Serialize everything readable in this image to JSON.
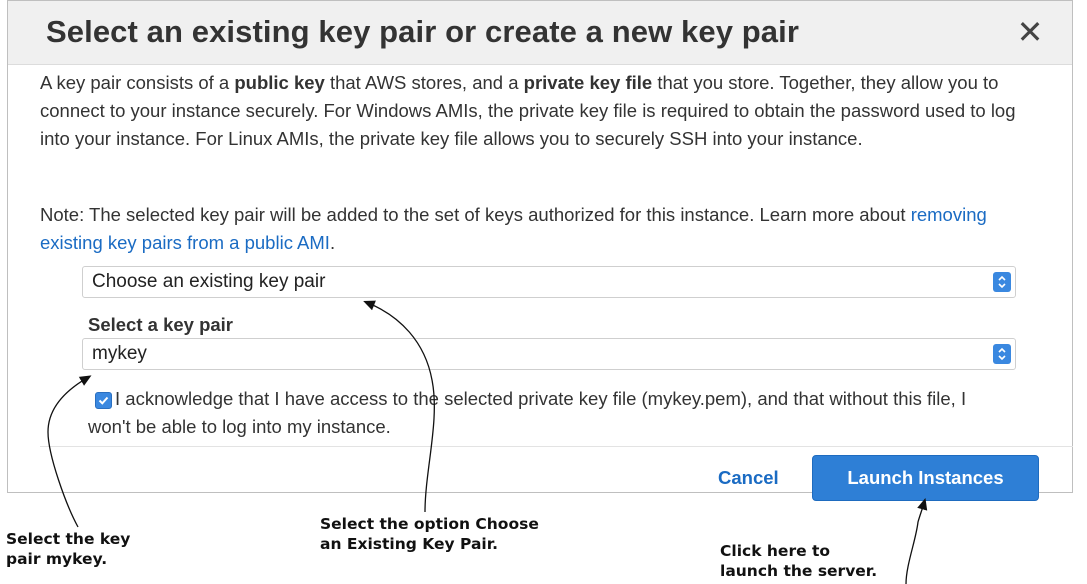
{
  "dialog": {
    "title": "Select an existing key pair or create a new key pair",
    "close_glyph": "✕",
    "para1": {
      "t1": "A key pair consists of a ",
      "b1": "public key",
      "t2": " that AWS stores, and a ",
      "b2": "private key file",
      "t3": " that you store. Together, they allow you to connect to your instance securely. For Windows AMIs, the private key file is required to obtain the password used to log into your instance. For Linux AMIs, the private key file allows you to securely SSH into your instance."
    },
    "para2": {
      "t1": "Note: The selected key pair will be added to the set of keys authorized for this instance. Learn more about ",
      "link": "removing existing key pairs from a public AMI",
      "t2": "."
    },
    "key_pair_option_select": {
      "value": "Choose an existing key pair"
    },
    "select_key_pair_label": "Select a key pair",
    "key_pair_select": {
      "value": "mykey"
    },
    "acknowledge": {
      "checked": true,
      "text": "I acknowledge that I have access to the selected private key file (mykey.pem), and that without this file, I won't be able to log into my instance."
    },
    "cancel_label": "Cancel",
    "launch_label": "Launch Instances"
  },
  "callouts": {
    "select_key_pair": [
      "Select the key",
      "pair mykey."
    ],
    "choose_option": [
      "Select the option Choose",
      "an Existing Key Pair."
    ],
    "launch_server": [
      "Click here to",
      "launch the server."
    ]
  },
  "colors": {
    "accent": "#2e7fd6",
    "link": "#1a6bc3",
    "header_bg": "#f0f0f0"
  },
  "icons": {
    "close": "close-icon",
    "select_arrows": "updown-chevron-icon",
    "checkbox": "checkmark-icon"
  }
}
